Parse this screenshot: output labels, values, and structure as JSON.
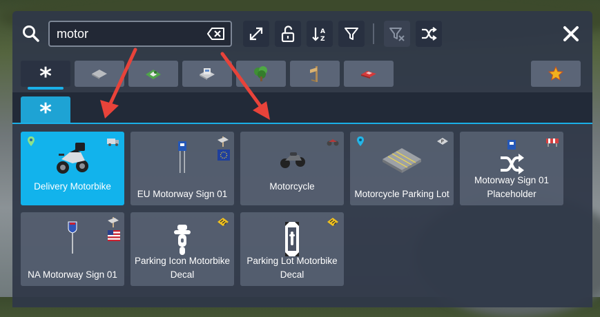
{
  "search": {
    "value": "motor",
    "icon": "search-icon"
  },
  "toolbar": {
    "buttons": [
      {
        "icon": "expand-icon"
      },
      {
        "icon": "unlock-icon"
      },
      {
        "icon": "sort-alpha-icon"
      },
      {
        "icon": "filter-icon"
      },
      {
        "icon": "clear-filter-icon"
      },
      {
        "icon": "shuffle-icon"
      }
    ],
    "close_icon": "close-icon"
  },
  "category_tabs": [
    {
      "icon": "asterisk-icon",
      "active": true
    },
    {
      "icon": "road-tile-icon"
    },
    {
      "icon": "terrain-icon"
    },
    {
      "icon": "building-icon"
    },
    {
      "icon": "tree-icon"
    },
    {
      "icon": "sign-post-icon"
    },
    {
      "icon": "car-icon"
    },
    {
      "icon": "star-icon"
    }
  ],
  "subtab": {
    "icon": "asterisk-icon"
  },
  "items": [
    {
      "label": "Delivery Motorbike",
      "selected": true
    },
    {
      "label": "EU Motorway Sign 01"
    },
    {
      "label": "Motorcycle"
    },
    {
      "label": "Motorcycle Parking Lot"
    },
    {
      "label": "Motorway Sign 01 Placeholder"
    },
    {
      "label": "NA Motorway Sign 01"
    },
    {
      "label": "Parking Icon Motorbike Decal"
    },
    {
      "label": "Parking Lot Motorbike Decal"
    }
  ],
  "colors": {
    "accent": "#1ab0e8",
    "selected_card": "#12b3ec",
    "arrow": "#e8433a"
  }
}
